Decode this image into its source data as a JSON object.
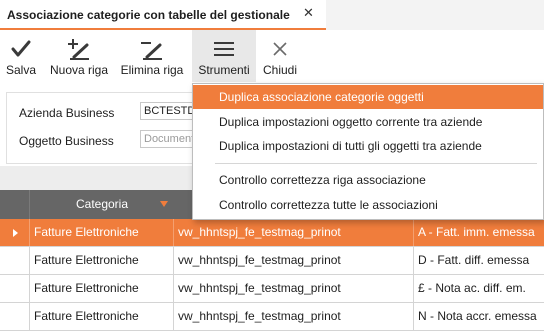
{
  "tab": {
    "title": "Associazione categorie con tabelle del gestionale",
    "close_symbol": "✕"
  },
  "toolbar": {
    "buttons": [
      {
        "label": "Salva",
        "icon": "checkmark-icon"
      },
      {
        "label": "Nuova riga",
        "icon": "add-row-icon"
      },
      {
        "label": "Elimina riga",
        "icon": "delete-row-icon"
      },
      {
        "label": "Strumenti",
        "icon": "hamburger-menu-icon",
        "active": true
      },
      {
        "label": "Chiudi",
        "icon": "close-icon"
      }
    ]
  },
  "form": {
    "azienda_label": "Azienda Business",
    "azienda_value": "BCTESTDB",
    "oggetto_label": "Oggetto Business",
    "oggetto_placeholder": "Documenti"
  },
  "menu": {
    "items": [
      "Duplica associazione categorie oggetti",
      "Duplica impostazioni oggetto corrente tra aziende",
      "Duplica impostazioni di tutti gli oggetti tra aziende",
      "Controllo correttezza riga associazione",
      "Controllo correttezza tutte le associazioni"
    ],
    "highlighted_index": 0
  },
  "grid": {
    "columns": [
      "Categoria",
      "",
      ""
    ],
    "rows": [
      {
        "categoria": "Fatture Elettroniche",
        "tabella": "vw_hhntspj_fe_testmag_prinot",
        "codice": "A - Fatt. imm. emessa",
        "selected": true
      },
      {
        "categoria": "Fatture Elettroniche",
        "tabella": "vw_hhntspj_fe_testmag_prinot",
        "codice": "D - Fatt. diff. emessa",
        "selected": false
      },
      {
        "categoria": "Fatture Elettroniche",
        "tabella": "vw_hhntspj_fe_testmag_prinot",
        "codice": "£ - Nota ac. diff. em.",
        "selected": false
      },
      {
        "categoria": "Fatture Elettroniche",
        "tabella": "vw_hhntspj_fe_testmag_prinot",
        "codice": "N - Nota accr. emessa",
        "selected": false
      }
    ]
  },
  "colors": {
    "accent": "#f07d3c",
    "header_bg": "#666666",
    "selected_row": "#f07d3c"
  }
}
